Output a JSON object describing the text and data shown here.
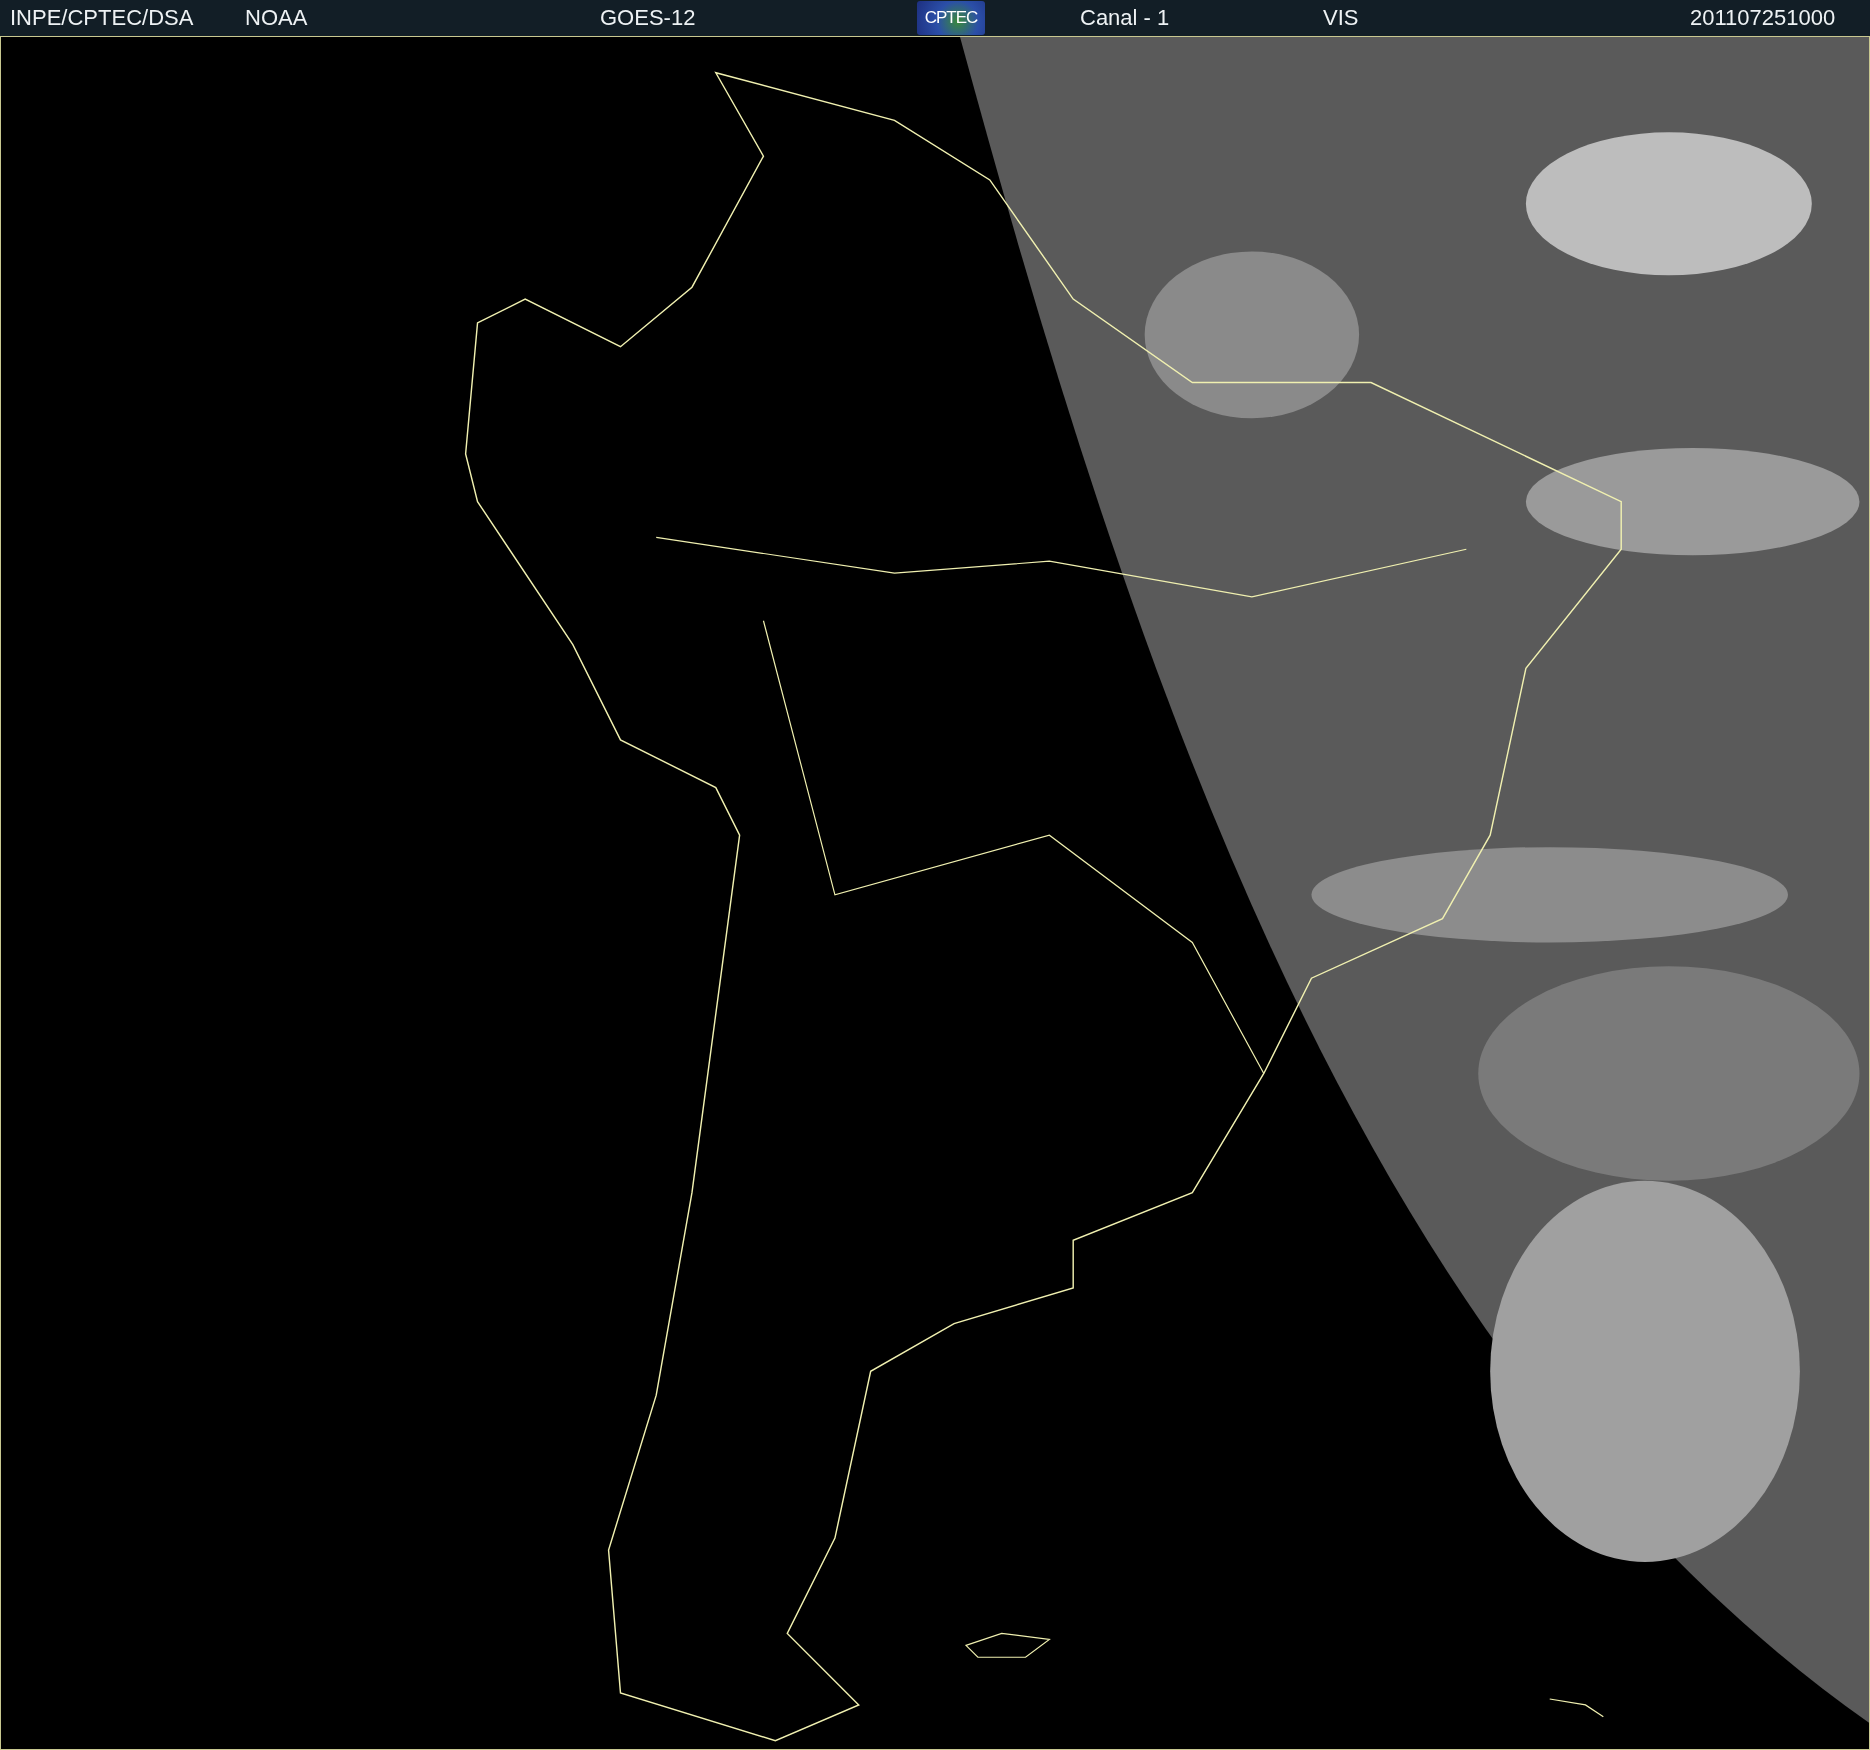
{
  "header": {
    "items": [
      {
        "kind": "text",
        "text": "INPE/CPTEC/DSA"
      },
      {
        "kind": "text",
        "text": "NOAA"
      },
      {
        "kind": "text",
        "text": "GOES-12"
      },
      {
        "kind": "logo",
        "text": "CPTEC"
      },
      {
        "kind": "text",
        "text": "Canal - 1"
      },
      {
        "kind": "text",
        "text": "VIS"
      },
      {
        "kind": "text",
        "text": "201107251000"
      }
    ]
  }
}
